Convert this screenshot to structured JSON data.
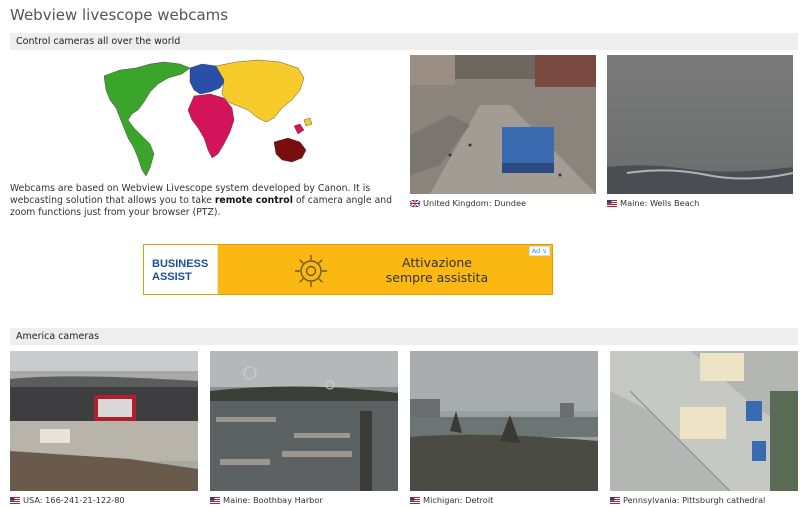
{
  "page": {
    "title": "Webview livescope webcams"
  },
  "sections": {
    "control": "Control cameras all over the world",
    "america": "America cameras"
  },
  "intro": {
    "part1": "Webcams are based on Webview Livescope system developed by Canon. It is webcasting solution that allows you to take ",
    "bold": "remote control",
    "part2": " of camera angle and zoom functions just from your browser (PTZ)."
  },
  "ad": {
    "logo_line1": "BUSINESS",
    "logo_line2": "ASSIST",
    "text_line1": "Attivazione",
    "text_line2": "sempre assistita",
    "badge": "Ad ∨"
  },
  "featured_cams": [
    {
      "caption": "United Kingdom: Dundee",
      "flag": "uk"
    },
    {
      "caption": "Maine: Wells Beach",
      "flag": "us"
    }
  ],
  "america_cams": [
    {
      "caption": "USA: 166-241-21-122-80",
      "flag": "us"
    },
    {
      "caption": "Maine: Boothbay Harbor",
      "flag": "us"
    },
    {
      "caption": "Michigan: Detroit",
      "flag": "us"
    },
    {
      "caption": "Pennsylvania: Pittsburgh cathedral",
      "flag": "us"
    }
  ],
  "colors": {
    "map_north_america": "#3aa52a",
    "map_europe": "#2a4fa8",
    "map_asia": "#f7cc2a",
    "map_africa": "#d4145a",
    "map_australia": "#7a0e0e",
    "ad_background": "#fbb813",
    "ad_logo": "#1a4fa0"
  }
}
